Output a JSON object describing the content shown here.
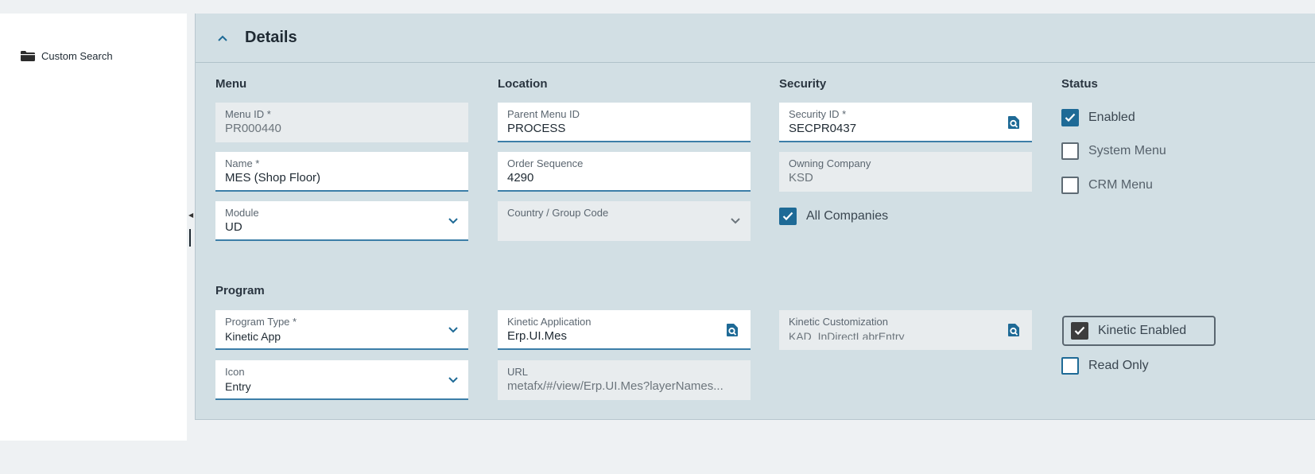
{
  "sidebar": {
    "items": [
      {
        "label": "Custom Search",
        "icon": "folder-icon"
      }
    ]
  },
  "panel": {
    "title": "Details"
  },
  "sections": {
    "menu": "Menu",
    "location": "Location",
    "security": "Security",
    "status": "Status",
    "program": "Program"
  },
  "fields": {
    "menu_id": {
      "label": "Menu ID *",
      "value": "PR000440"
    },
    "name": {
      "label": "Name *",
      "value": "MES (Shop Floor)"
    },
    "module": {
      "label": "Module",
      "value": "UD"
    },
    "parent_menu_id": {
      "label": "Parent Menu ID",
      "value": "PROCESS"
    },
    "order_sequence": {
      "label": "Order Sequence",
      "value": "4290"
    },
    "country_group_code": {
      "label": "Country / Group Code",
      "value": ""
    },
    "security_id": {
      "label": "Security ID *",
      "value": "SECPR0437"
    },
    "owning_company": {
      "label": "Owning Company",
      "value": "KSD"
    },
    "program_type": {
      "label": "Program Type *",
      "value": "Kinetic App"
    },
    "icon": {
      "label": "Icon",
      "value": "Entry"
    },
    "kinetic_application": {
      "label": "Kinetic Application",
      "value": "Erp.UI.Mes"
    },
    "url": {
      "label": "URL",
      "value": "metafx/#/view/Erp.UI.Mes?layerNames..."
    },
    "kinetic_customization": {
      "label": "Kinetic Customization",
      "value": "KAD_InDirectLabrEntry"
    }
  },
  "checkboxes": {
    "all_companies": {
      "label": "All Companies",
      "checked": true
    },
    "enabled": {
      "label": "Enabled",
      "checked": true
    },
    "system_menu": {
      "label": "System Menu",
      "checked": false
    },
    "crm_menu": {
      "label": "CRM Menu",
      "checked": false
    },
    "kinetic_enabled": {
      "label": "Kinetic Enabled",
      "checked": true
    },
    "read_only": {
      "label": "Read Only",
      "checked": false
    }
  },
  "colors": {
    "accent": "#1e6a96",
    "panel_bg": "#d2dfe4",
    "field_underline": "#3c7ea8"
  }
}
